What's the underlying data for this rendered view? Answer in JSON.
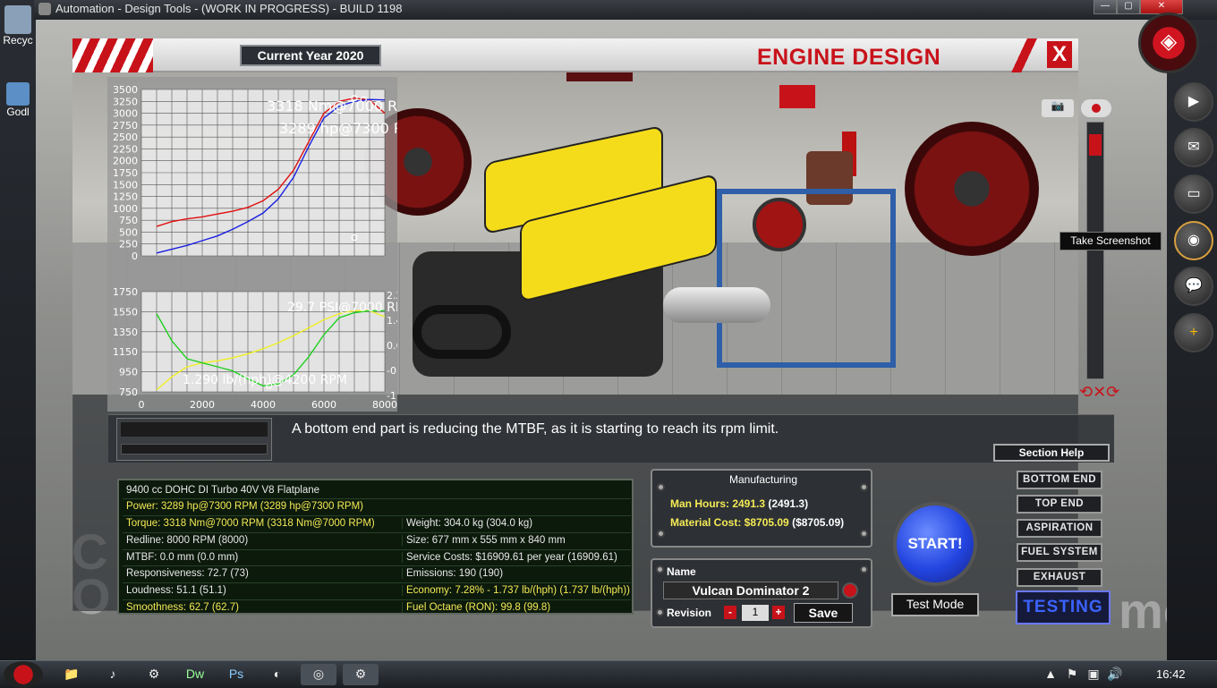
{
  "window": {
    "title": "Automation - Design Tools - (WORK IN PROGRESS) - BUILD 1198"
  },
  "desktop": {
    "icons": [
      "Recyc",
      "Godl"
    ]
  },
  "header": {
    "current_year": "Current Year 2020",
    "title": "ENGINE DESIGN",
    "close": "X"
  },
  "background": {
    "left_letters": "C\nO",
    "right_letters": "me"
  },
  "graphs": {
    "torque_label": "3318 Nm@7000 RPM",
    "power_label": "3289 hp@7300 RPM",
    "boost_label": "29.7 PSI@7000 RPM",
    "bsfc_label": "1.290 lb/(hph)@4200 RPM",
    "top_yticks": [
      "3500",
      "3250",
      "3000",
      "2750",
      "2500",
      "2250",
      "2000",
      "1750",
      "1500",
      "1250",
      "1000",
      "750",
      "500",
      "250",
      "0"
    ],
    "bottom_left_yticks": [
      "1750",
      "1550",
      "1350",
      "1150",
      "950",
      "750"
    ],
    "bottom_right_yticks": [
      "2.2",
      "1.4",
      "0.6",
      "-0.2",
      "-1.0"
    ],
    "xticks": [
      "0",
      "2000",
      "4000",
      "6000",
      "8000"
    ]
  },
  "chart_data": [
    {
      "type": "line",
      "x": [
        500,
        1000,
        1500,
        2000,
        2500,
        3000,
        3500,
        4000,
        4500,
        5000,
        5500,
        6000,
        6500,
        7000,
        7500,
        8000
      ],
      "series": [
        {
          "values": [
            620,
            720,
            780,
            820,
            880,
            940,
            1020,
            1160,
            1400,
            1800,
            2400,
            3000,
            3250,
            3318,
            3280,
            3000
          ]
        },
        {
          "values": [
            60,
            140,
            220,
            320,
            420,
            560,
            720,
            900,
            1200,
            1650,
            2300,
            2900,
            3150,
            3250,
            3289,
            3280
          ]
        }
      ],
      "ylim": [
        0,
        3500
      ],
      "xlim": [
        0,
        8000
      ]
    },
    {
      "type": "line",
      "x": [
        500,
        1000,
        1500,
        2000,
        2500,
        3000,
        3500,
        4000,
        4500,
        5000,
        5500,
        6000,
        6500,
        7000,
        7500,
        8000
      ],
      "series": [
        {
          "values": [
            770,
            900,
            1000,
            1040,
            1060,
            1090,
            1130,
            1180,
            1240,
            1310,
            1390,
            1470,
            1530,
            1560,
            1560,
            1500
          ]
        },
        {
          "values": [
            1530,
            1260,
            1080,
            1040,
            1000,
            960,
            880,
            810,
            830,
            920,
            1100,
            1320,
            1490,
            1540,
            1560,
            1560
          ]
        }
      ],
      "ylim": [
        750,
        1750
      ],
      "xlim": [
        0,
        8000
      ]
    }
  ],
  "message": "A bottom end part is reducing the MTBF, as it is starting to reach its rpm limit.",
  "section_help": "Section Help",
  "stats": {
    "title": "9400 cc DOHC DI Turbo 40V V8 Flatplane",
    "rows": [
      [
        "Power: 3289 hp@7300 RPM (3289 hp@7300 RPM)",
        ""
      ],
      [
        "Torque: 3318 Nm@7000 RPM (3318 Nm@7000 RPM)",
        "Weight: 304.0 kg (304.0 kg)"
      ],
      [
        "Redline: 8000 RPM (8000)",
        "Size: 677 mm x 555 mm x 840 mm"
      ],
      [
        "MTBF: 0.0 mm (0.0 mm)",
        "Service Costs: $16909.61 per year (16909.61)"
      ],
      [
        "Responsiveness: 72.7 (73)",
        "Emissions: 190 (190)"
      ],
      [
        "Loudness: 51.1 (51.1)",
        "Economy: 7.28% - 1.737 lb/(hph) (1.737 lb/(hph))"
      ],
      [
        "Smoothness: 62.7 (62.7)",
        "Fuel Octane (RON): 99.8 (99.8)"
      ]
    ]
  },
  "manufacturing": {
    "heading": "Manufacturing",
    "man_hours_label": "Man Hours: 2491.3",
    "man_hours_paren": "(2491.3)",
    "material_label": "Material Cost: $8705.09",
    "material_paren": "($8705.09)"
  },
  "name_panel": {
    "label": "Name",
    "value": "Vulcan Dominator 2",
    "revision_label": "Revision",
    "revision": "1",
    "minus": "-",
    "plus": "+",
    "save": "Save"
  },
  "start_button": "START!",
  "test_mode": "Test Mode",
  "sections": [
    "BOTTOM END",
    "TOP END",
    "ASPIRATION",
    "FUEL SYSTEM",
    "EXHAUST"
  ],
  "testing": "TESTING",
  "tooltip": "Take Screenshot",
  "dock_icons": [
    "youtube-icon",
    "mail-icon",
    "video-icon",
    "camera-icon",
    "chat-icon",
    "plus-icon"
  ],
  "clock": "16:42",
  "colors": {
    "accent_red": "#c8121a",
    "torque": "#e01010",
    "power": "#1a20e0",
    "boost": "#f0f020",
    "bsfc": "#20d020",
    "start_blue": "#2345e0"
  }
}
